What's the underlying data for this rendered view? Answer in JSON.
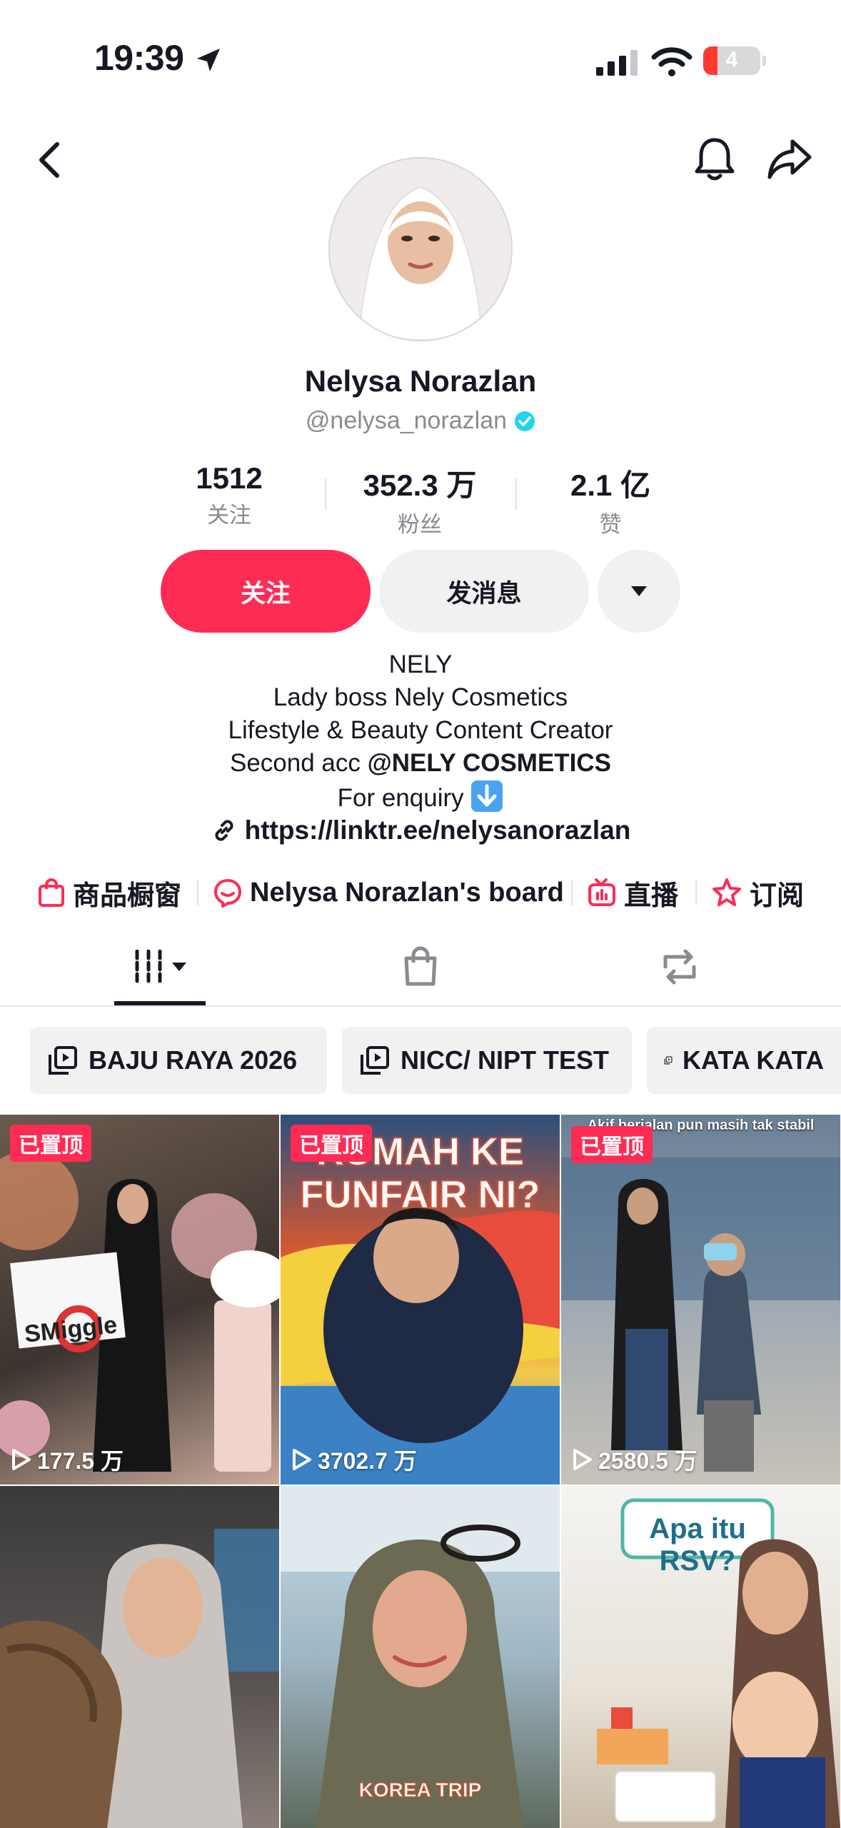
{
  "status_bar": {
    "time": "19:39",
    "battery": "4"
  },
  "profile": {
    "name": "Nelysa Norazlan",
    "handle": "@nelysa_norazlan",
    "stats": [
      {
        "value": "1512",
        "label": "关注"
      },
      {
        "value": "352.3 万",
        "label": "粉丝"
      },
      {
        "value": "2.1 亿",
        "label": "赞"
      }
    ],
    "follow_label": "关注",
    "message_label": "发消息",
    "bio": [
      "NELY",
      "Lady boss Nely Cosmetics",
      "Lifestyle & Beauty Content Creator",
      "Second acc",
      "@NELY COSMETICS",
      "For enquiry"
    ],
    "link": "https://linktr.ee/nelysanorazlan"
  },
  "shortcuts": [
    {
      "label": "商品橱窗",
      "icon": "shopping-bag-icon"
    },
    {
      "label": "Nelysa Norazlan's board",
      "icon": "board-icon"
    },
    {
      "label": "直播",
      "icon": "live-tv-icon"
    },
    {
      "label": "订阅",
      "icon": "subscribe-star-icon"
    }
  ],
  "tabs": [
    "videos-grid-icon",
    "shop-bag-icon",
    "repost-icon"
  ],
  "playlists": [
    "BAJU RAYA 2026",
    "NICC/ NIPT TEST",
    "KATA KATA"
  ],
  "videos": [
    {
      "pinned": "已置顶",
      "views": "177.5 万",
      "caption": "SMiggle"
    },
    {
      "pinned": "已置顶",
      "views": "3702.7 万",
      "caption": "RUMAH KE FUNFAIR NI?"
    },
    {
      "pinned": "已置顶",
      "views": "2580.5 万",
      "caption": "Akif berjalan pun masih tak stabil"
    },
    {
      "pinned": "",
      "views": "",
      "caption": ""
    },
    {
      "pinned": "",
      "views": "",
      "caption": "KOREA TRIP"
    },
    {
      "pinned": "",
      "views": "",
      "caption": "Apa itu RSV?"
    }
  ],
  "colors": {
    "accent": "#fe2c55",
    "verified": "#20d5ec"
  }
}
